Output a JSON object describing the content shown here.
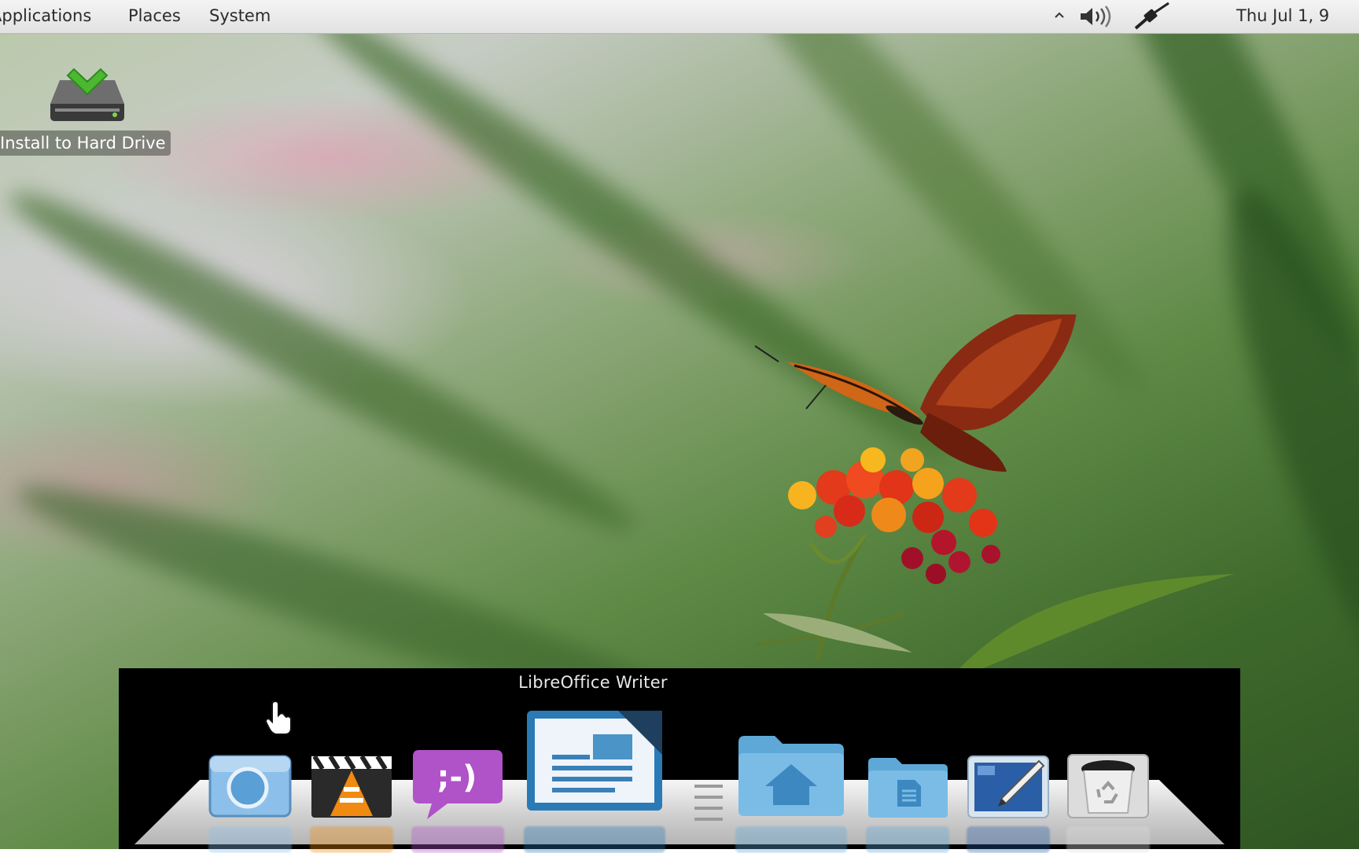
{
  "top_panel": {
    "menus": [
      "Applications",
      "Places",
      "System"
    ],
    "tray": {
      "arrow_icon": "up-arrow-icon",
      "volume_icon": "volume-icon",
      "network_icon": "network-cable-icon",
      "clock": "Thu Jul  1,  9"
    }
  },
  "desktop": {
    "icons": [
      {
        "label": "Install to Hard Drive",
        "icon": "install-drive-icon"
      }
    ]
  },
  "dock": {
    "tooltip": "LibreOffice Writer",
    "items": [
      {
        "icon": "chromium-icon"
      },
      {
        "icon": "vlc-icon"
      },
      {
        "icon": "pidgin-icon"
      },
      {
        "icon": "libreoffice-writer-icon"
      },
      {
        "icon": "home-folder-icon"
      },
      {
        "icon": "documents-folder-icon"
      },
      {
        "icon": "drawing-app-icon"
      },
      {
        "icon": "trash-icon"
      }
    ]
  },
  "colors": {
    "panel_bg": "#ececec",
    "dock_bg": "#000000",
    "folder_blue": "#5ea8d8",
    "pidgin_purple": "#b052c8"
  }
}
